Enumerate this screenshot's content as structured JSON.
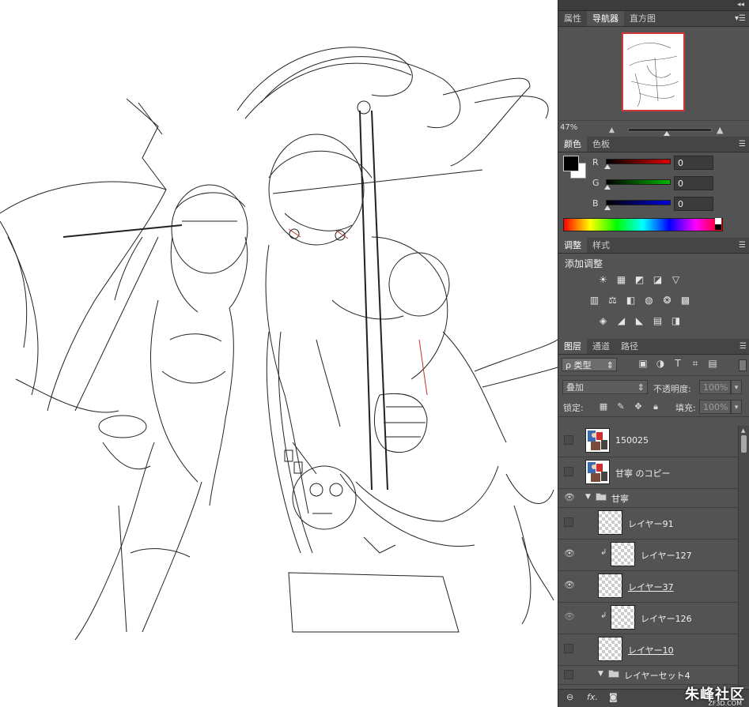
{
  "collapse_icon": "double-chevron-icon",
  "panel_menu_icon": "panel-menu-icon",
  "navigator": {
    "tabs": [
      "属性",
      "导航器",
      "直方图"
    ],
    "active_tab": 1,
    "zoom": "47%",
    "zoom_level": 0.47
  },
  "color": {
    "tabs": [
      "颜色",
      "色板"
    ],
    "fg": "#000000",
    "bg": "#ffffff",
    "channels": [
      {
        "label": "R",
        "value": "0",
        "color": "#e00000"
      },
      {
        "label": "G",
        "value": "0",
        "color": "#00b800"
      },
      {
        "label": "B",
        "value": "0",
        "color": "#0000e0"
      }
    ]
  },
  "adjustments": {
    "tabs": [
      "调整",
      "样式"
    ],
    "title": "添加调整",
    "rows": [
      [
        "brightness-icon",
        "levels-icon",
        "curves-icon",
        "exposure-icon",
        "vibrance-icon"
      ],
      [
        "hue-saturation-icon",
        "color-balance-icon",
        "black-white-icon",
        "photo-filter-icon",
        "channel-mixer-icon",
        "color-lookup-icon"
      ],
      [
        "invert-icon",
        "posterize-icon",
        "threshold-icon",
        "gradient-map-icon",
        "selective-color-icon"
      ]
    ],
    "glyphs": {
      "brightness-icon": "☀",
      "levels-icon": "▦",
      "curves-icon": "◩",
      "exposure-icon": "◪",
      "vibrance-icon": "▽",
      "hue-saturation-icon": "▥",
      "color-balance-icon": "⚖",
      "black-white-icon": "◧",
      "photo-filter-icon": "◍",
      "channel-mixer-icon": "❂",
      "color-lookup-icon": "▩",
      "invert-icon": "◈",
      "posterize-icon": "◢",
      "threshold-icon": "◣",
      "gradient-map-icon": "▤",
      "selective-color-icon": "◨"
    }
  },
  "layers": {
    "tabs": [
      "图层",
      "通道",
      "路径"
    ],
    "filter_label": "ρ 类型",
    "blend_mode": "叠加",
    "opacity_label": "不透明度:",
    "opacity_value": "100%",
    "lock_label": "锁定:",
    "fill_label": "填充:",
    "fill_value": "100%",
    "items": [
      {
        "name": "150025",
        "visible": false,
        "type": "layer",
        "thumb": "image",
        "indent": 0,
        "clipped": false,
        "underline": false
      },
      {
        "name": "甘寧 のコピー",
        "visible": false,
        "type": "layer",
        "thumb": "image",
        "indent": 0,
        "clipped": false,
        "underline": false
      },
      {
        "name": "甘寧",
        "visible": true,
        "type": "group",
        "indent": 0
      },
      {
        "name": "レイヤー91",
        "visible": false,
        "type": "layer",
        "thumb": "transparent",
        "indent": 1,
        "clipped": false,
        "underline": false
      },
      {
        "name": "レイヤー127",
        "visible": true,
        "type": "layer",
        "thumb": "transparent",
        "indent": 1,
        "clipped": true,
        "underline": false
      },
      {
        "name": "レイヤー37",
        "visible": true,
        "type": "layer",
        "thumb": "transparent",
        "indent": 1,
        "clipped": false,
        "underline": true
      },
      {
        "name": "レイヤー126",
        "visible": true,
        "dim": true,
        "type": "layer",
        "thumb": "transparent",
        "indent": 1,
        "clipped": true,
        "underline": false
      },
      {
        "name": "レイヤー10",
        "visible": false,
        "type": "layer",
        "thumb": "transparent",
        "indent": 1,
        "clipped": false,
        "underline": true
      },
      {
        "name": "レイヤーセット4",
        "visible": false,
        "type": "group",
        "indent": 1
      }
    ]
  },
  "watermark": {
    "text": "朱峰社区",
    "sub": "ZF3D.COM"
  }
}
